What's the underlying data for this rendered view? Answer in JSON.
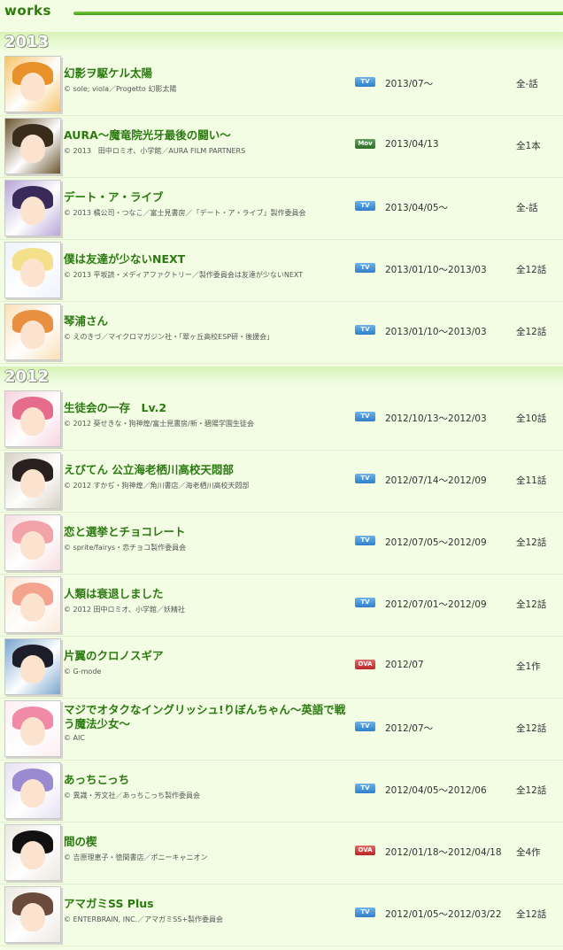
{
  "header": {
    "logo": "works"
  },
  "years": [
    {
      "label": "2013",
      "works": [
        {
          "title": "幻影ヲ駆ケル太陽",
          "copyright": "© sole; viola／Progetto 幻影太陽",
          "type": "TV",
          "date": "2013/07〜",
          "episodes": "全-話",
          "colors": [
            "#f7c46a",
            "#e8902a"
          ]
        },
        {
          "title": "AURA〜魔竜院光牙最後の闘い〜",
          "copyright": "© 2013　田中ロミオ、小学館／AURA FILM PARTNERS",
          "type": "Mov",
          "date": "2013/04/13",
          "episodes": "全1本",
          "colors": [
            "#6a5430",
            "#3a2c1a"
          ]
        },
        {
          "title": "デート・ア・ライブ",
          "copyright": "© 2013 橘公司・つなこ／富士見書房／「デート・ア・ライブ」製作委員会",
          "type": "TV",
          "date": "2013/04/05〜",
          "episodes": "全-話",
          "colors": [
            "#b7a6d8",
            "#3a2a5a"
          ]
        },
        {
          "title": "僕は友達が少ないNEXT",
          "copyright": "© 2013 平坂読・メディアファクトリー／製作委員会は友達が少ないNEXT",
          "type": "TV",
          "date": "2013/01/10〜2013/03",
          "episodes": "全12話",
          "colors": [
            "#eef2fb",
            "#f4e08a"
          ]
        },
        {
          "title": "琴浦さん",
          "copyright": "© えのきづ／マイクロマガジン社・「翠ヶ丘高校ESP研・後援会」",
          "type": "TV",
          "date": "2013/01/10〜2013/03",
          "episodes": "全12話",
          "colors": [
            "#fbe0b8",
            "#e89040"
          ]
        }
      ]
    },
    {
      "label": "2012",
      "works": [
        {
          "title": "生徒会の一存　Lv.2",
          "copyright": "© 2012 葵せきな・狗神煌/富士見書房/新・碧陽学園生徒会",
          "type": "TV",
          "date": "2012/10/13〜2012/03",
          "episodes": "全10話",
          "colors": [
            "#f7d3de",
            "#e56c8c"
          ]
        },
        {
          "title": "えびてん 公立海老栖川高校天悶部",
          "copyright": "© 2012 すかぢ・狗神煌／角川書店／海老栖川高校天悶部",
          "type": "TV",
          "date": "2012/07/14〜2012/09",
          "episodes": "全11話",
          "colors": [
            "#d8d2c6",
            "#2a2020"
          ]
        },
        {
          "title": "恋と選挙とチョコレート",
          "copyright": "© sprite/fairys・恋チョコ製作委員会",
          "type": "TV",
          "date": "2012/07/05〜2012/09",
          "episodes": "全12話",
          "colors": [
            "#f6dde0",
            "#f1a3a8"
          ]
        },
        {
          "title": "人類は衰退しました",
          "copyright": "© 2012 田中ロミオ、小学館／妖精社",
          "type": "TV",
          "date": "2012/07/01〜2012/09",
          "episodes": "全12話",
          "colors": [
            "#fbe9d8",
            "#f3a38e"
          ]
        },
        {
          "title": "片翼のクロノスギア",
          "copyright": "© G-mode",
          "type": "OVA",
          "date": "2012/07",
          "episodes": "全1作",
          "colors": [
            "#7aa6d0",
            "#1e1e2a"
          ]
        },
        {
          "title": "マジでオタクなイングリッシュ!りぼんちゃん〜英語で戦う魔法少女〜",
          "copyright": "© AIC",
          "type": "TV",
          "date": "2012/07〜",
          "episodes": "全12話",
          "colors": [
            "#fdeef2",
            "#f08aa6"
          ]
        },
        {
          "title": "あっちこっち",
          "copyright": "© 異識・芳文社／あっちこっち製作委員会",
          "type": "TV",
          "date": "2012/04/05〜2012/06",
          "episodes": "全12話",
          "colors": [
            "#e6e1f3",
            "#9a8ad0"
          ]
        },
        {
          "title": "間の楔",
          "copyright": "© 吉原理恵子・徳間書店／ポニーキャニオン",
          "type": "OVA",
          "date": "2012/01/18〜2012/04/18",
          "episodes": "全4作",
          "colors": [
            "#ece8e0",
            "#111111"
          ]
        },
        {
          "title": "アマガミSS Plus",
          "copyright": "© ENTERBRAIN, INC.／アマガミSS+製作委員会",
          "type": "TV",
          "date": "2012/01/05〜2012/03/22",
          "episodes": "全12話",
          "colors": [
            "#ece8e2",
            "#6a4a3a"
          ]
        }
      ]
    }
  ]
}
